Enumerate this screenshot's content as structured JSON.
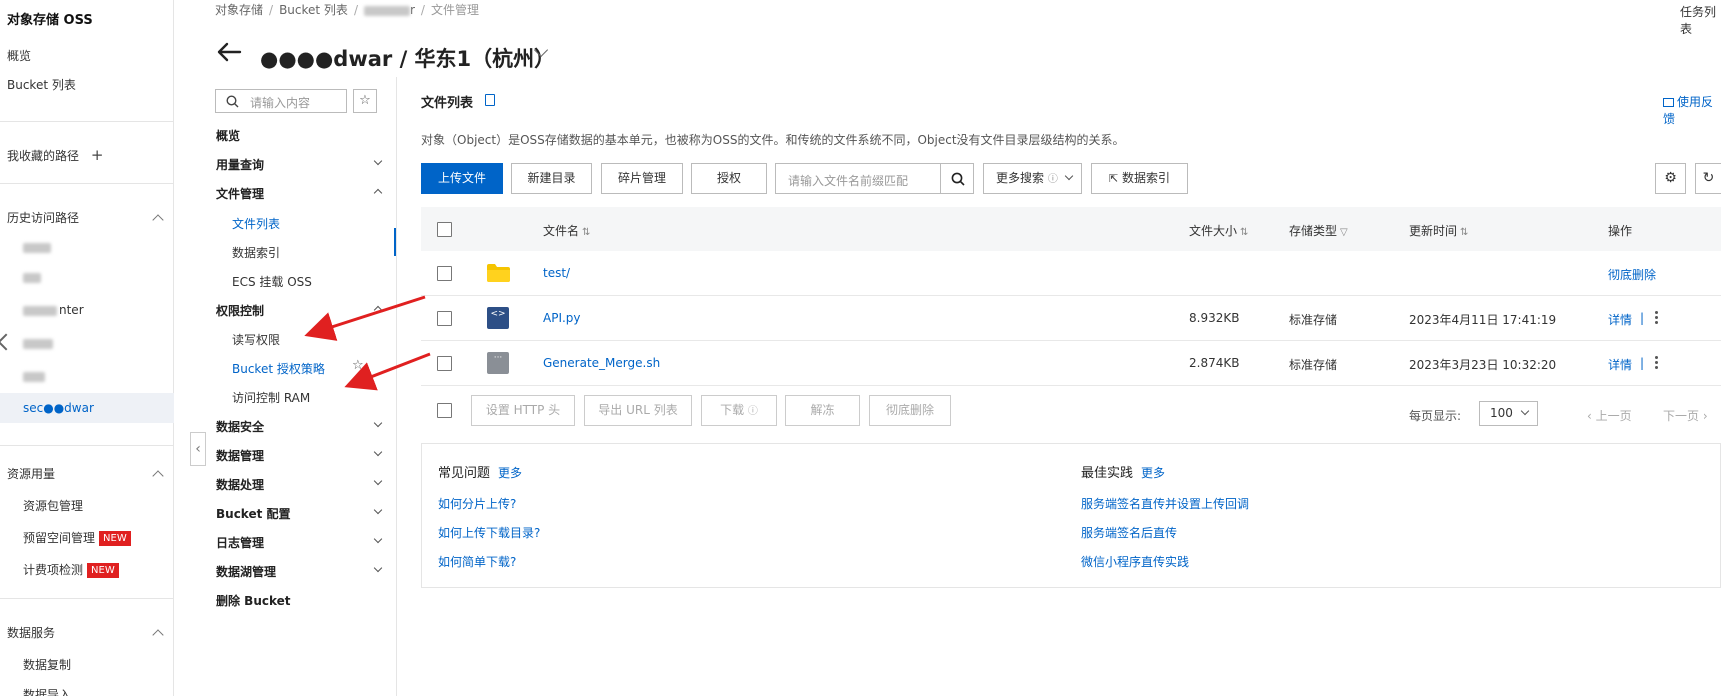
{
  "sidebar": {
    "title": "对象存储 OSS",
    "overview": "概览",
    "bucket_list": "Bucket 列表",
    "favorites": "我收藏的路径",
    "favorites_add": "+",
    "history": "历史访问路径",
    "history_items": [
      {
        "label": "lĩ",
        "blurred": true
      },
      {
        "label": "·",
        "blurred": true
      },
      {
        "label": "nter",
        "blurred": true
      },
      {
        "label": "",
        "blurred": true
      },
      {
        "label": "",
        "blurred": true
      },
      {
        "label": "sec●●dwar",
        "blurred": true
      }
    ],
    "resource_usage": "资源用量",
    "resource_items": [
      "资源包管理",
      "预留空间管理",
      "计费项检测"
    ],
    "new_badge": "NEW",
    "data_services": "数据服务",
    "data_service_items": [
      "数据复制",
      "数据导入"
    ]
  },
  "breadcrumb": {
    "items": [
      "对象存储",
      "Bucket 列表",
      "r",
      "文件管理"
    ]
  },
  "task_list": "任务列表",
  "header": {
    "title": "●●●●dwar / 华东1（杭州）"
  },
  "secondary_nav": {
    "search_placeholder": "请输入内容",
    "star": "☆",
    "groups": {
      "overview": "概览",
      "usage": "用量查询",
      "file_mgmt": "文件管理",
      "file_list": "文件列表",
      "data_index": "数据索引",
      "ecs_mount": "ECS 挂载 OSS",
      "access_control": "权限控制",
      "rw_perm": "读写权限",
      "bucket_policy": "Bucket 授权策略",
      "ram": "访问控制 RAM",
      "data_security": "数据安全",
      "data_mgmt": "数据管理",
      "data_processing": "数据处理",
      "bucket_config": "Bucket 配置",
      "log_mgmt": "日志管理",
      "data_lake": "数据湖管理",
      "delete_bucket": "删除 Bucket"
    }
  },
  "main": {
    "title": "文件列表",
    "feedback": "使用反馈",
    "description": "对象（Object）是OSS存储数据的基本单元，也被称为OSS的文件。和传统的文件系统不同，Object没有文件目录层级结构的关系。",
    "toolbar": {
      "upload": "上传文件",
      "new_dir": "新建目录",
      "fragments": "碎片管理",
      "authorize": "授权",
      "search_placeholder": "请输入文件名前缀匹配",
      "more_search": "更多搜索",
      "data_index": "数据索引"
    },
    "table": {
      "columns": [
        "文件名",
        "文件大小",
        "存储类型",
        "更新时间",
        "操作"
      ],
      "rows": [
        {
          "name": "test/",
          "size": "",
          "storage": "",
          "updated": "",
          "actions": [
            "彻底删除"
          ],
          "icon": "folder-icon"
        },
        {
          "name": "API.py",
          "size": "8.932KB",
          "storage": "标准存储",
          "updated": "2023年4月11日 17:41:19",
          "actions": [
            "详情",
            "|"
          ],
          "icon": "code-file-icon"
        },
        {
          "name": "Generate_Merge.sh",
          "size": "2.874KB",
          "storage": "标准存储",
          "updated": "2023年3月23日 10:32:20",
          "actions": [
            "详情",
            "|"
          ],
          "icon": "script-file-icon"
        }
      ]
    },
    "batch": {
      "set_http_header": "设置 HTTP 头",
      "export_url": "导出 URL 列表",
      "download": "下载",
      "unfreeze": "解冻",
      "delete": "彻底删除",
      "per_page_label": "每页显示:",
      "per_page": "100",
      "prev": "上一页",
      "next": "下一页"
    },
    "faq": {
      "title": "常见问题",
      "more": "更多",
      "links": [
        "如何分片上传?",
        "如何上传下载目录?",
        "如何简单下载?"
      ]
    },
    "best_practice": {
      "title": "最佳实践",
      "more": "更多",
      "links": [
        "服务端签名直传并设置上传回调",
        "服务端签名后直传",
        "微信小程序直传实践"
      ]
    }
  },
  "colors": {
    "accent": "#0064c8",
    "annotation_arrow": "#e02020",
    "badge": "#e02020"
  }
}
